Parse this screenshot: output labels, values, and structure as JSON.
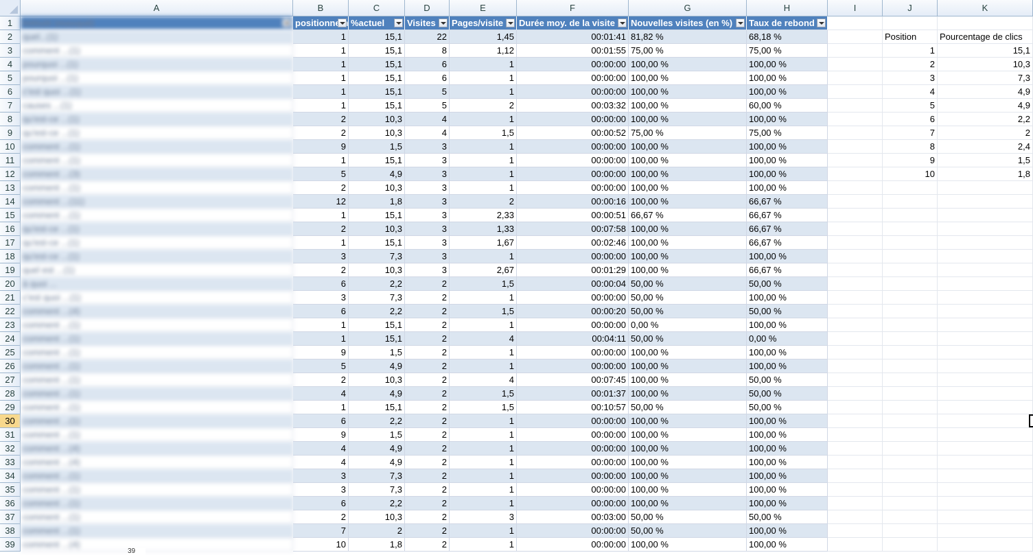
{
  "column_letters": [
    "A",
    "B",
    "C",
    "D",
    "E",
    "F",
    "G",
    "H",
    "I",
    "J",
    "K"
  ],
  "table": {
    "headers": [
      "Intitulé (masqué)",
      "positionnement",
      "%actuel",
      "Visites",
      "Pages/visite",
      "Durée moy. de la visite",
      "Nouvelles visites (en %)",
      "Taux de rebond"
    ],
    "rows": [
      [
        "quel...(1)",
        "1",
        "15,1",
        "22",
        "1,45",
        "00:01:41",
        "81,82 %",
        "68,18 %"
      ],
      [
        "comment ...(1)",
        "1",
        "15,1",
        "8",
        "1,12",
        "00:01:55",
        "75,00 %",
        "75,00 %"
      ],
      [
        "pourquoi ...(1)",
        "1",
        "15,1",
        "6",
        "1",
        "00:00:00",
        "100,00 %",
        "100,00 %"
      ],
      [
        "pourquoi ...(1)",
        "1",
        "15,1",
        "6",
        "1",
        "00:00:00",
        "100,00 %",
        "100,00 %"
      ],
      [
        "c'est quoi ...(1)",
        "1",
        "15,1",
        "5",
        "1",
        "00:00:00",
        "100,00 %",
        "100,00 %"
      ],
      [
        "causes ...(1)",
        "1",
        "15,1",
        "5",
        "2",
        "00:03:32",
        "100,00 %",
        "60,00 %"
      ],
      [
        "qu'est-ce ...(1)",
        "2",
        "10,3",
        "4",
        "1",
        "00:00:00",
        "100,00 %",
        "100,00 %"
      ],
      [
        "qu'est-ce ...(1)",
        "2",
        "10,3",
        "4",
        "1,5",
        "00:00:52",
        "75,00 %",
        "75,00 %"
      ],
      [
        "comment ...(1)",
        "9",
        "1,5",
        "3",
        "1",
        "00:00:00",
        "100,00 %",
        "100,00 %"
      ],
      [
        "comment ...(1)",
        "1",
        "15,1",
        "3",
        "1",
        "00:00:00",
        "100,00 %",
        "100,00 %"
      ],
      [
        "comment ...(3)",
        "5",
        "4,9",
        "3",
        "1",
        "00:00:00",
        "100,00 %",
        "100,00 %"
      ],
      [
        "comment ...(1)",
        "2",
        "10,3",
        "3",
        "1",
        "00:00:00",
        "100,00 %",
        "100,00 %"
      ],
      [
        "comment ...(11)",
        "12",
        "1,8",
        "3",
        "2",
        "00:00:16",
        "100,00 %",
        "66,67 %"
      ],
      [
        "comment ...(1)",
        "1",
        "15,1",
        "3",
        "2,33",
        "00:00:51",
        "66,67 %",
        "66,67 %"
      ],
      [
        "qu'est-ce ...(1)",
        "2",
        "10,3",
        "3",
        "1,33",
        "00:07:58",
        "100,00 %",
        "66,67 %"
      ],
      [
        "qu'est-ce ...(1)",
        "1",
        "15,1",
        "3",
        "1,67",
        "00:02:46",
        "100,00 %",
        "66,67 %"
      ],
      [
        "qu'est-ce ...(1)",
        "3",
        "7,3",
        "3",
        "1",
        "00:00:00",
        "100,00 %",
        "100,00 %"
      ],
      [
        "quel est ...(1)",
        "2",
        "10,3",
        "3",
        "2,67",
        "00:01:29",
        "100,00 %",
        "66,67 %"
      ],
      [
        "à quoi ...",
        "6",
        "2,2",
        "2",
        "1,5",
        "00:00:04",
        "50,00 %",
        "50,00 %"
      ],
      [
        "c'est quoi ...(1)",
        "3",
        "7,3",
        "2",
        "1",
        "00:00:00",
        "50,00 %",
        "100,00 %"
      ],
      [
        "comment ...(4)",
        "6",
        "2,2",
        "2",
        "1,5",
        "00:00:20",
        "50,00 %",
        "50,00 %"
      ],
      [
        "comment ...(1)",
        "1",
        "15,1",
        "2",
        "1",
        "00:00:00",
        "0,00 %",
        "100,00 %"
      ],
      [
        "comment ...(1)",
        "1",
        "15,1",
        "2",
        "4",
        "00:04:11",
        "50,00 %",
        "0,00 %"
      ],
      [
        "comment ...(1)",
        "9",
        "1,5",
        "2",
        "1",
        "00:00:00",
        "100,00 %",
        "100,00 %"
      ],
      [
        "comment ...(1)",
        "5",
        "4,9",
        "2",
        "1",
        "00:00:00",
        "100,00 %",
        "100,00 %"
      ],
      [
        "comment ...(1)",
        "2",
        "10,3",
        "2",
        "4",
        "00:07:45",
        "100,00 %",
        "50,00 %"
      ],
      [
        "comment ...(1)",
        "4",
        "4,9",
        "2",
        "1,5",
        "00:01:37",
        "100,00 %",
        "50,00 %"
      ],
      [
        "comment ...(1)",
        "1",
        "15,1",
        "2",
        "1,5",
        "00:10:57",
        "50,00 %",
        "50,00 %"
      ],
      [
        "comment ...(1)",
        "6",
        "2,2",
        "2",
        "1",
        "00:00:00",
        "100,00 %",
        "100,00 %"
      ],
      [
        "comment ...(1)",
        "9",
        "1,5",
        "2",
        "1",
        "00:00:00",
        "100,00 %",
        "100,00 %"
      ],
      [
        "comment ...(4)",
        "4",
        "4,9",
        "2",
        "1",
        "00:00:00",
        "100,00 %",
        "100,00 %"
      ],
      [
        "comment ...(4)",
        "4",
        "4,9",
        "2",
        "1",
        "00:00:00",
        "100,00 %",
        "100,00 %"
      ],
      [
        "comment ...(1)",
        "3",
        "7,3",
        "2",
        "1",
        "00:00:00",
        "100,00 %",
        "100,00 %"
      ],
      [
        "comment ...(1)",
        "3",
        "7,3",
        "2",
        "1",
        "00:00:00",
        "100,00 %",
        "100,00 %"
      ],
      [
        "comment ...(1)",
        "6",
        "2,2",
        "2",
        "1",
        "00:00:00",
        "100,00 %",
        "100,00 %"
      ],
      [
        "comment ...(1)",
        "2",
        "10,3",
        "2",
        "3",
        "00:03:00",
        "50,00 %",
        "50,00 %"
      ],
      [
        "comment ...(1)",
        "7",
        "2",
        "2",
        "1",
        "00:00:00",
        "50,00 %",
        "100,00 %"
      ],
      [
        "comment ...(4)",
        "10",
        "1,8",
        "2",
        "1",
        "00:00:00",
        "100,00 %",
        "100,00 %"
      ]
    ]
  },
  "side_table": {
    "headers": [
      "Position",
      "Pourcentage de clics"
    ],
    "rows": [
      [
        "1",
        "15,1"
      ],
      [
        "2",
        "10,3"
      ],
      [
        "3",
        "7,3"
      ],
      [
        "4",
        "4,9"
      ],
      [
        "5",
        "4,9"
      ],
      [
        "6",
        "2,2"
      ],
      [
        "7",
        "2"
      ],
      [
        "8",
        "2,4"
      ],
      [
        "9",
        "1,5"
      ],
      [
        "10",
        "1,8"
      ]
    ]
  },
  "selected_row": 30,
  "sheet_tab_label": "39"
}
